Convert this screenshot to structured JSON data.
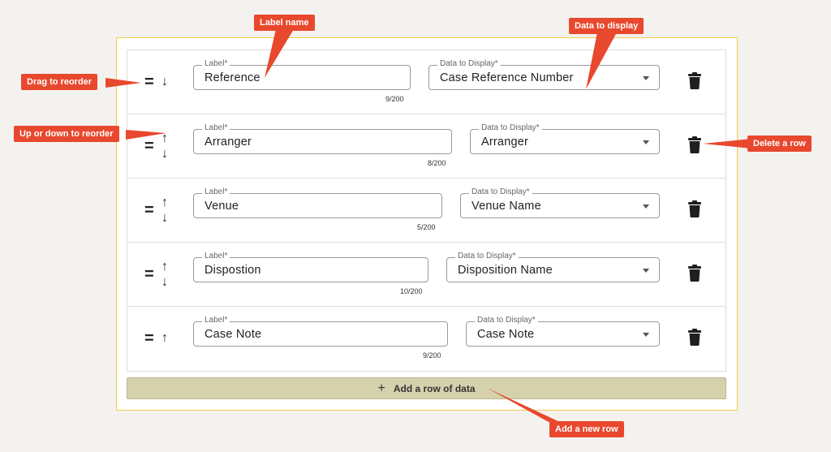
{
  "form": {
    "rows": [
      {
        "label_caption": "Label*",
        "label_value": "Reference",
        "label_count": "9/200",
        "data_caption": "Data to Display*",
        "data_value": "Case Reference Number",
        "arrows": [
          "↓"
        ]
      },
      {
        "label_caption": "Label*",
        "label_value": "Arranger",
        "label_count": "8/200",
        "data_caption": "Data to Display*",
        "data_value": "Arranger",
        "arrows": [
          "↑",
          "↓"
        ]
      },
      {
        "label_caption": "Label*",
        "label_value": "Venue",
        "label_count": "5/200",
        "data_caption": "Data to Display*",
        "data_value": "Venue Name",
        "arrows": [
          "↑",
          "↓"
        ]
      },
      {
        "label_caption": "Label*",
        "label_value": "Dispostion",
        "label_count": "10/200",
        "data_caption": "Data to Display*",
        "data_value": "Disposition Name",
        "arrows": [
          "↑",
          "↓"
        ]
      },
      {
        "label_caption": "Label*",
        "label_value": "Case Note",
        "label_count": "9/200",
        "data_caption": "Data to Display*",
        "data_value": "Case Note",
        "arrows": [
          "↑"
        ]
      }
    ],
    "drag_glyph": "=",
    "add_row_icon": "+",
    "add_row_label": "Add a row of data"
  },
  "annotations": {
    "label_name": "Label name",
    "data_to_display": "Data to display",
    "drag_to_reorder": "Drag to reorder",
    "up_down_reorder": "Up or down to reorder",
    "delete_row": "Delete a row",
    "add_new_row": "Add a new row"
  },
  "colors": {
    "callout": "#e8482d",
    "frame_border": "#f2c94c",
    "add_button": "#d6d1ad"
  },
  "icons": [
    "drag-handle-icon",
    "arrow-up-icon",
    "arrow-down-icon",
    "trash-icon",
    "plus-icon"
  ]
}
